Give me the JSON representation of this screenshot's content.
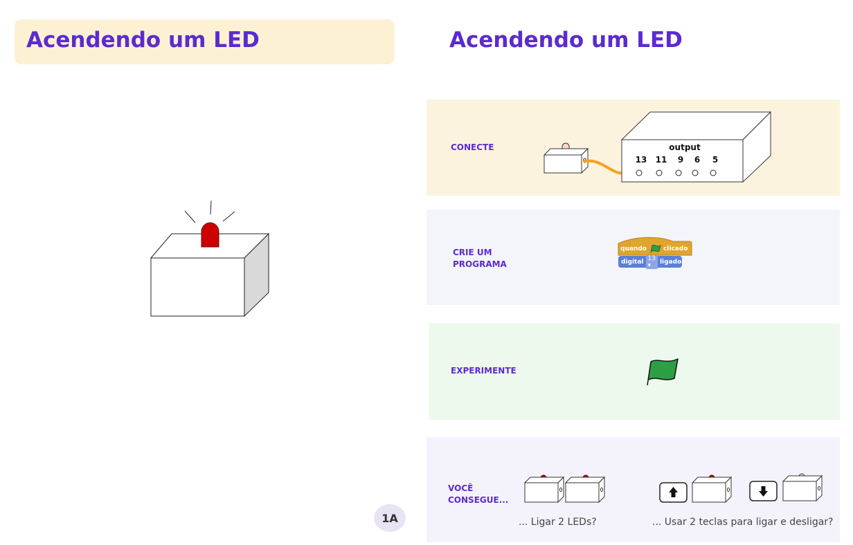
{
  "left": {
    "title": "Acendendo um LED",
    "page_badge": "1A"
  },
  "right": {
    "title": "Acendendo um LED",
    "steps": [
      {
        "label": "CONECTE"
      },
      {
        "label": "CRIE UM PROGRAMA"
      },
      {
        "label": "EXPERIMENTE"
      },
      {
        "label": "VOCÊ CONSEGUE..."
      }
    ],
    "output_box": {
      "label": "output",
      "pins": [
        "13",
        "11",
        "9",
        "6",
        "5"
      ]
    },
    "program": {
      "hat_block": {
        "prefix": "quando",
        "suffix": "clicado",
        "icon": "green-flag-icon"
      },
      "command_block": {
        "prefix": "digital",
        "pin": "13",
        "suffix": "ligado"
      }
    },
    "challenges": [
      {
        "caption": "... Ligar  2 LEDs?"
      },
      {
        "caption": "... Usar 2 teclas para ligar e desligar?"
      }
    ]
  },
  "colors": {
    "title": "#5b2bd0",
    "title_bg": "#fdf1d3",
    "led_red": "#cc0000",
    "led_off": "#f7d6d6",
    "wire": "#f5a21e",
    "flag_green": "#2e9e45",
    "panel_conecte": "#fbf3dd",
    "panel_programa": "#f3f5fa",
    "panel_experimente": "#eef9ee",
    "panel_voce": "#f4f3fb",
    "block_event": "#e0a52c",
    "block_command": "#5b7fd6"
  }
}
